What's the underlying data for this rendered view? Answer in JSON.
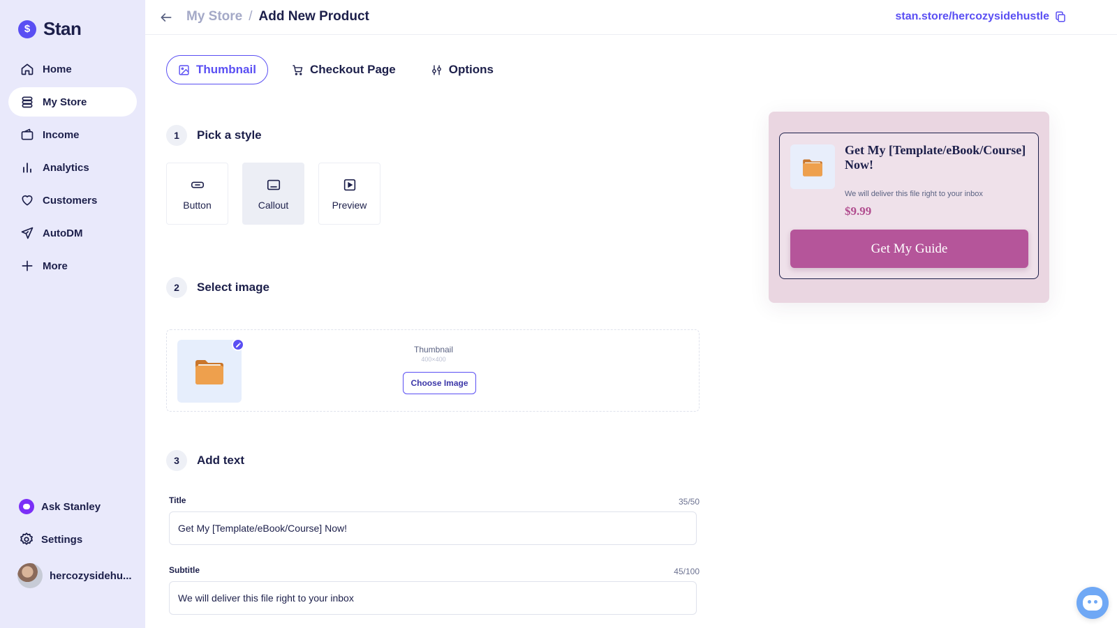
{
  "brand": {
    "name": "Stan",
    "logo_symbol": "$",
    "accent": "#5a4ff3"
  },
  "sidebar": {
    "items": [
      {
        "label": "Home",
        "icon": "home-icon"
      },
      {
        "label": "My Store",
        "icon": "store-icon",
        "active": true
      },
      {
        "label": "Income",
        "icon": "wallet-icon"
      },
      {
        "label": "Analytics",
        "icon": "bar-chart-icon"
      },
      {
        "label": "Customers",
        "icon": "heart-icon"
      },
      {
        "label": "AutoDM",
        "icon": "send-icon"
      },
      {
        "label": "More",
        "icon": "plus-icon"
      }
    ],
    "ask_stanley": "Ask Stanley",
    "settings": "Settings",
    "profile_name": "hercozysidehu..."
  },
  "header": {
    "breadcrumb_parent": "My Store",
    "breadcrumb_sep": "/",
    "breadcrumb_current": "Add New Product",
    "store_url": "stan.store/hercozysidehustle"
  },
  "tabs": [
    {
      "label": "Thumbnail",
      "icon": "image-icon",
      "active": true
    },
    {
      "label": "Checkout Page",
      "icon": "cart-icon"
    },
    {
      "label": "Options",
      "icon": "sliders-icon"
    }
  ],
  "steps": {
    "s1": {
      "num": "1",
      "title": "Pick a style"
    },
    "s2": {
      "num": "2",
      "title": "Select image"
    },
    "s3": {
      "num": "3",
      "title": "Add text"
    }
  },
  "styles": [
    {
      "label": "Button",
      "icon": "button-style-icon"
    },
    {
      "label": "Callout",
      "icon": "callout-style-icon",
      "selected": true
    },
    {
      "label": "Preview",
      "icon": "play-preview-icon"
    }
  ],
  "image": {
    "label": "Thumbnail",
    "size": "400×400",
    "choose_label": "Choose Image"
  },
  "form": {
    "title_label": "Title",
    "title_count": "35/50",
    "title_value": "Get My [Template/eBook/Course] Now!",
    "subtitle_label": "Subtitle",
    "subtitle_count": "45/100",
    "subtitle_value": "We will deliver this file right to your inbox"
  },
  "preview": {
    "title": "Get My [Template/eBook/Course] Now!",
    "subtitle": "We will deliver this file right to your inbox",
    "price": "$9.99",
    "button_label": "Get My Guide",
    "button_color": "#b5559a"
  }
}
